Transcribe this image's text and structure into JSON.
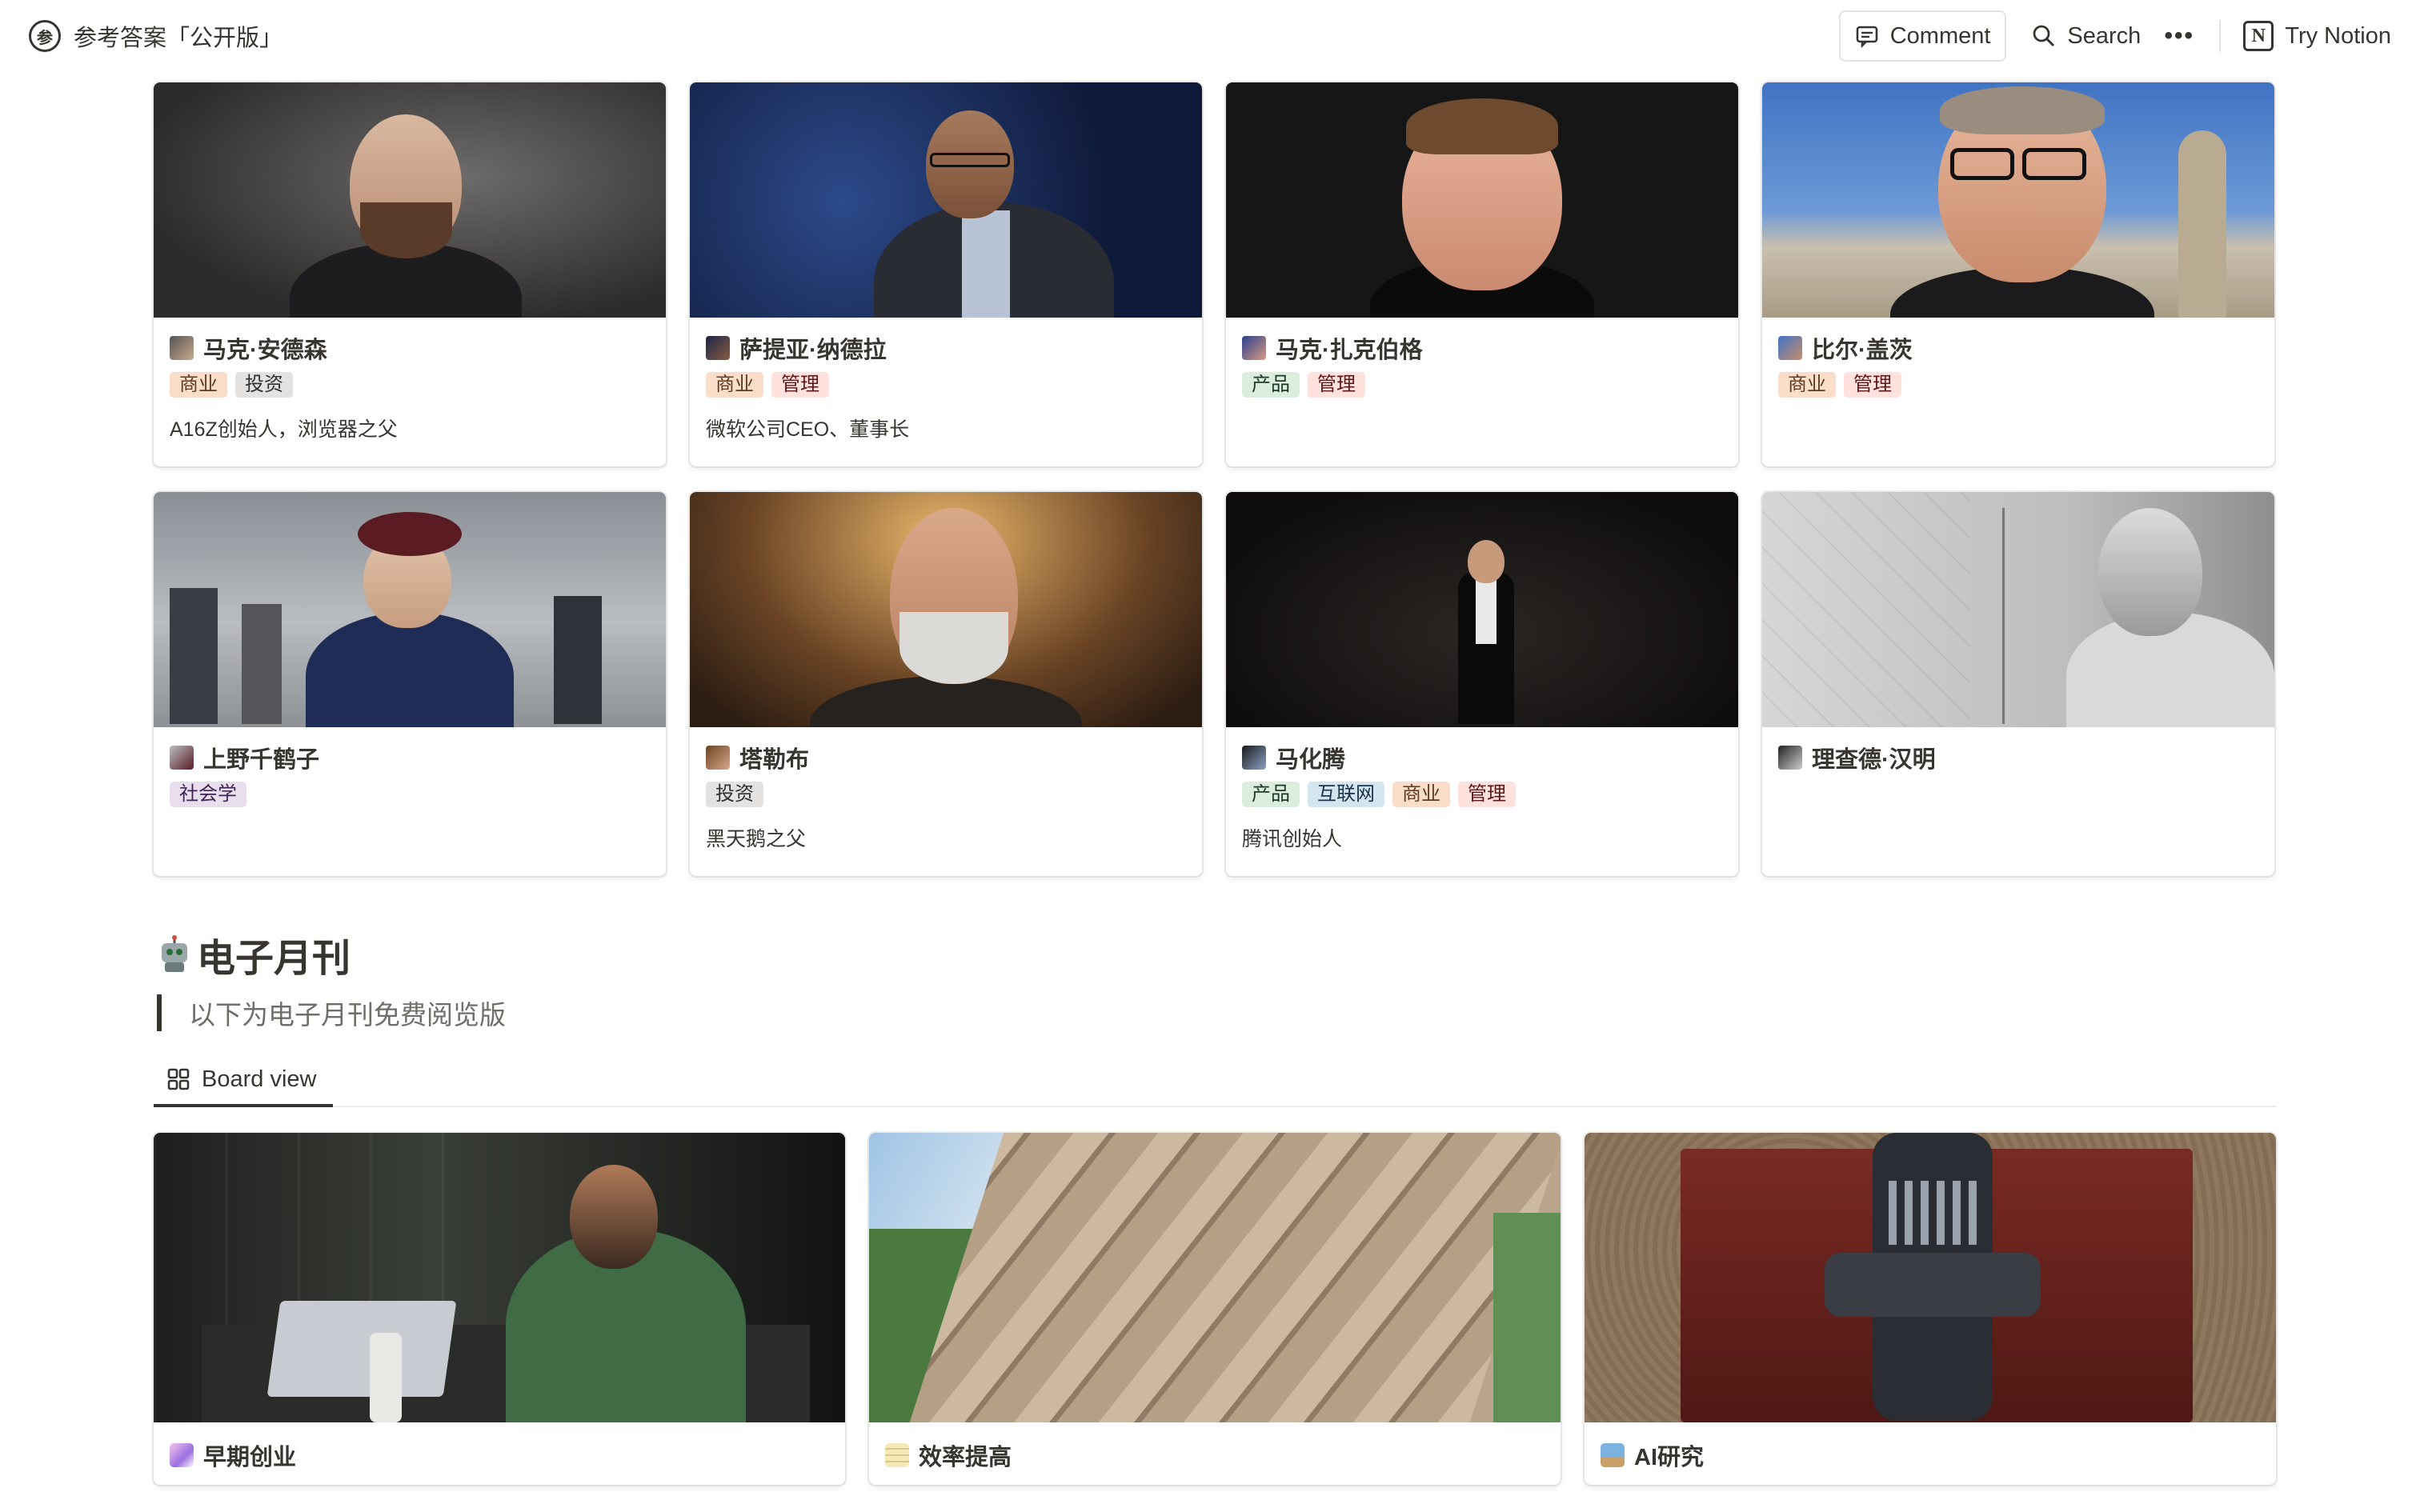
{
  "header": {
    "workspace_title": "参考答案「公开版」",
    "brand_glyph": "参",
    "comment_label": "Comment",
    "search_label": "Search",
    "more_label": "•••",
    "try_notion_label": "Try Notion",
    "notion_glyph": "N"
  },
  "people": [
    {
      "name": "马克·安德森",
      "tags": [
        {
          "label": "商业",
          "bg": "#fadec9",
          "fg": "#5c3b23"
        },
        {
          "label": "投资",
          "bg": "#e3e2e0",
          "fg": "#32302c"
        }
      ],
      "desc": "A16Z创始人，浏览器之父"
    },
    {
      "name": "萨提亚·纳德拉",
      "tags": [
        {
          "label": "商业",
          "bg": "#fadec9",
          "fg": "#5c3b23"
        },
        {
          "label": "管理",
          "bg": "#ffe2dd",
          "fg": "#5d1715"
        }
      ],
      "desc": "微软公司CEO、董事长"
    },
    {
      "name": "马克·扎克伯格",
      "tags": [
        {
          "label": "产品",
          "bg": "#dbeddb",
          "fg": "#1c3829"
        },
        {
          "label": "管理",
          "bg": "#ffe2dd",
          "fg": "#5d1715"
        }
      ],
      "desc": ""
    },
    {
      "name": "比尔·盖茨",
      "tags": [
        {
          "label": "商业",
          "bg": "#fadec9",
          "fg": "#5c3b23"
        },
        {
          "label": "管理",
          "bg": "#ffe2dd",
          "fg": "#5d1715"
        }
      ],
      "desc": ""
    },
    {
      "name": "上野千鹤子",
      "tags": [
        {
          "label": "社会学",
          "bg": "#e8deee",
          "fg": "#412454"
        }
      ],
      "desc": ""
    },
    {
      "name": "塔勒布",
      "tags": [
        {
          "label": "投资",
          "bg": "#e3e2e0",
          "fg": "#32302c"
        }
      ],
      "desc": "黑天鹅之父"
    },
    {
      "name": "马化腾",
      "tags": [
        {
          "label": "产品",
          "bg": "#dbeddb",
          "fg": "#1c3829"
        },
        {
          "label": "互联网",
          "bg": "#d3e5ef",
          "fg": "#183347"
        },
        {
          "label": "商业",
          "bg": "#fadec9",
          "fg": "#5c3b23"
        },
        {
          "label": "管理",
          "bg": "#ffe2dd",
          "fg": "#5d1715"
        }
      ],
      "desc": "腾讯创始人"
    },
    {
      "name": "理查德·汉明",
      "tags": [],
      "desc": ""
    }
  ],
  "section": {
    "title": "电子月刊",
    "quote": "以下为电子月刊免费阅览版",
    "tab_label": "Board view"
  },
  "board": [
    {
      "title": "早期创业",
      "icon": "unicorn-icon"
    },
    {
      "title": "效率提高",
      "icon": "memo-icon"
    },
    {
      "title": "AI研究",
      "icon": "robot-icon"
    }
  ]
}
